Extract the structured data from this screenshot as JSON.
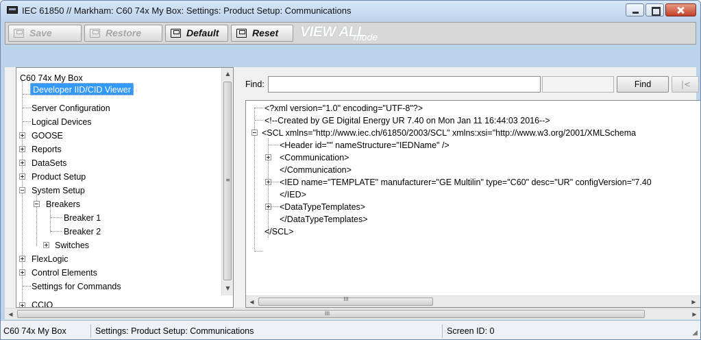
{
  "window": {
    "title": "IEC 61850 // Markham: C60 74x My Box: Settings: Product Setup: Communications"
  },
  "toolbar": {
    "save_label": "Save",
    "restore_label": "Restore",
    "default_label": "Default",
    "reset_label": "Reset",
    "viewall_main": "VIEW ALL",
    "viewall_sub": "mode"
  },
  "tree": {
    "root": "C60 74x My Box",
    "items": [
      {
        "label": "Developer IID/CID Viewer",
        "selected": true
      },
      {
        "label": "Server Configuration"
      },
      {
        "label": "Logical Devices"
      },
      {
        "label": "GOOSE"
      },
      {
        "label": "Reports"
      },
      {
        "label": "DataSets"
      },
      {
        "label": "Product Setup"
      },
      {
        "label": "System Setup"
      },
      {
        "label": "Breakers"
      },
      {
        "label": "Breaker 1"
      },
      {
        "label": "Breaker 2"
      },
      {
        "label": "Switches"
      },
      {
        "label": "FlexLogic"
      },
      {
        "label": "Control Elements"
      },
      {
        "label": "Settings for Commands"
      },
      {
        "label": "CCIO"
      }
    ]
  },
  "find": {
    "label": "Find:",
    "value": "",
    "button_label": "Find",
    "first_label": "|<"
  },
  "xml": {
    "lines": [
      "<?xml version=\"1.0\" encoding=\"UTF-8\"?>",
      "<!--Created by GE Digital Energy UR 7.40 on Mon Jan 11 16:44:03 2016-->",
      "<SCL  xmlns=\"http://www.iec.ch/61850/2003/SCL\" xmlns:xsi=\"http://www.w3.org/2001/XMLSchema",
      "<Header id=\"\" nameStructure=\"IEDName\" />",
      "<Communication>",
      "</Communication>",
      "<IED name=\"TEMPLATE\" manufacturer=\"GE Multilin\" type=\"C60\" desc=\"UR\" configVersion=\"7.40",
      "</IED>",
      "<DataTypeTemplates>",
      "</DataTypeTemplates>",
      "</SCL>"
    ]
  },
  "scroll": {
    "thumb_label": "III"
  },
  "status": {
    "device": "C60 74x My Box",
    "path": "Settings: Product Setup: Communications",
    "screen_id": "Screen ID: 0"
  }
}
